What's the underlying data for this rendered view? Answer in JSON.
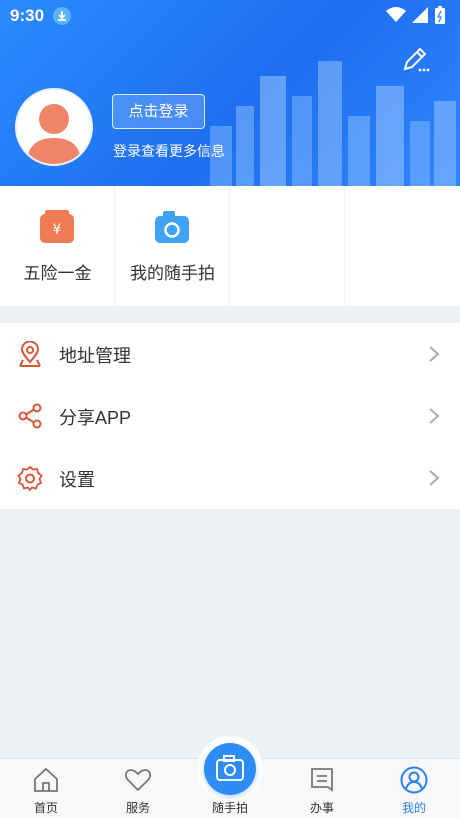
{
  "status": {
    "time": "9:30"
  },
  "header": {
    "login_button": "点击登录",
    "login_subtitle": "登录查看更多信息"
  },
  "quick_actions": [
    {
      "label": "五险一金",
      "icon": "wallet-yen-icon",
      "color": "#f07b55"
    },
    {
      "label": "我的随手拍",
      "icon": "camera-icon",
      "color": "#3fa2f7"
    }
  ],
  "menu": [
    {
      "label": "地址管理",
      "icon": "location-pin-icon"
    },
    {
      "label": "分享APP",
      "icon": "share-icon"
    },
    {
      "label": "设置",
      "icon": "gear-icon"
    }
  ],
  "bottom_nav": [
    {
      "label": "首页",
      "icon": "home-icon"
    },
    {
      "label": "服务",
      "icon": "heart-icon"
    },
    {
      "label": "随手拍",
      "icon": "camera-icon"
    },
    {
      "label": "办事",
      "icon": "document-icon"
    },
    {
      "label": "我的",
      "icon": "profile-icon",
      "active": true
    }
  ],
  "colors": {
    "accent": "#2b7ff2",
    "menu_icon": "#d9563a",
    "header": "#2b8cff"
  }
}
